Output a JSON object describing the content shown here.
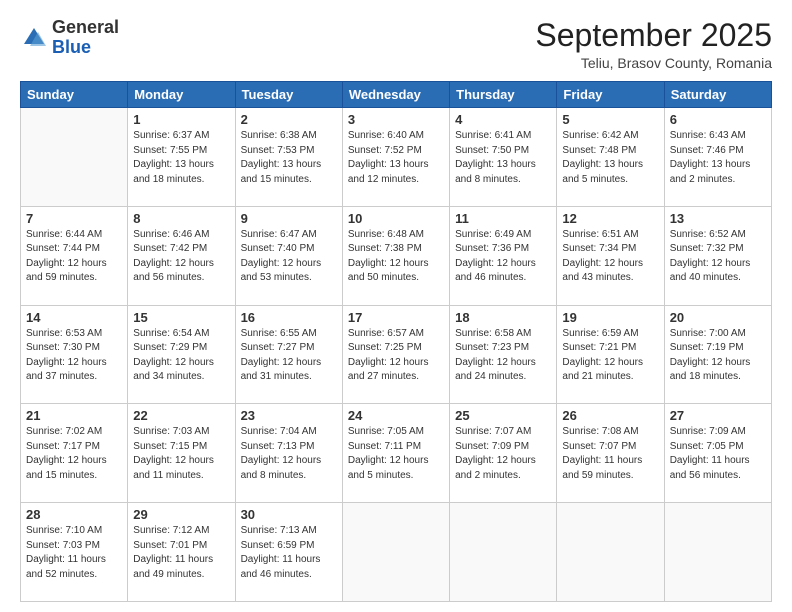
{
  "logo": {
    "general": "General",
    "blue": "Blue"
  },
  "header": {
    "month": "September 2025",
    "location": "Teliu, Brasov County, Romania"
  },
  "weekdays": [
    "Sunday",
    "Monday",
    "Tuesday",
    "Wednesday",
    "Thursday",
    "Friday",
    "Saturday"
  ],
  "weeks": [
    [
      {
        "day": "",
        "info": ""
      },
      {
        "day": "1",
        "info": "Sunrise: 6:37 AM\nSunset: 7:55 PM\nDaylight: 13 hours\nand 18 minutes."
      },
      {
        "day": "2",
        "info": "Sunrise: 6:38 AM\nSunset: 7:53 PM\nDaylight: 13 hours\nand 15 minutes."
      },
      {
        "day": "3",
        "info": "Sunrise: 6:40 AM\nSunset: 7:52 PM\nDaylight: 13 hours\nand 12 minutes."
      },
      {
        "day": "4",
        "info": "Sunrise: 6:41 AM\nSunset: 7:50 PM\nDaylight: 13 hours\nand 8 minutes."
      },
      {
        "day": "5",
        "info": "Sunrise: 6:42 AM\nSunset: 7:48 PM\nDaylight: 13 hours\nand 5 minutes."
      },
      {
        "day": "6",
        "info": "Sunrise: 6:43 AM\nSunset: 7:46 PM\nDaylight: 13 hours\nand 2 minutes."
      }
    ],
    [
      {
        "day": "7",
        "info": "Sunrise: 6:44 AM\nSunset: 7:44 PM\nDaylight: 12 hours\nand 59 minutes."
      },
      {
        "day": "8",
        "info": "Sunrise: 6:46 AM\nSunset: 7:42 PM\nDaylight: 12 hours\nand 56 minutes."
      },
      {
        "day": "9",
        "info": "Sunrise: 6:47 AM\nSunset: 7:40 PM\nDaylight: 12 hours\nand 53 minutes."
      },
      {
        "day": "10",
        "info": "Sunrise: 6:48 AM\nSunset: 7:38 PM\nDaylight: 12 hours\nand 50 minutes."
      },
      {
        "day": "11",
        "info": "Sunrise: 6:49 AM\nSunset: 7:36 PM\nDaylight: 12 hours\nand 46 minutes."
      },
      {
        "day": "12",
        "info": "Sunrise: 6:51 AM\nSunset: 7:34 PM\nDaylight: 12 hours\nand 43 minutes."
      },
      {
        "day": "13",
        "info": "Sunrise: 6:52 AM\nSunset: 7:32 PM\nDaylight: 12 hours\nand 40 minutes."
      }
    ],
    [
      {
        "day": "14",
        "info": "Sunrise: 6:53 AM\nSunset: 7:30 PM\nDaylight: 12 hours\nand 37 minutes."
      },
      {
        "day": "15",
        "info": "Sunrise: 6:54 AM\nSunset: 7:29 PM\nDaylight: 12 hours\nand 34 minutes."
      },
      {
        "day": "16",
        "info": "Sunrise: 6:55 AM\nSunset: 7:27 PM\nDaylight: 12 hours\nand 31 minutes."
      },
      {
        "day": "17",
        "info": "Sunrise: 6:57 AM\nSunset: 7:25 PM\nDaylight: 12 hours\nand 27 minutes."
      },
      {
        "day": "18",
        "info": "Sunrise: 6:58 AM\nSunset: 7:23 PM\nDaylight: 12 hours\nand 24 minutes."
      },
      {
        "day": "19",
        "info": "Sunrise: 6:59 AM\nSunset: 7:21 PM\nDaylight: 12 hours\nand 21 minutes."
      },
      {
        "day": "20",
        "info": "Sunrise: 7:00 AM\nSunset: 7:19 PM\nDaylight: 12 hours\nand 18 minutes."
      }
    ],
    [
      {
        "day": "21",
        "info": "Sunrise: 7:02 AM\nSunset: 7:17 PM\nDaylight: 12 hours\nand 15 minutes."
      },
      {
        "day": "22",
        "info": "Sunrise: 7:03 AM\nSunset: 7:15 PM\nDaylight: 12 hours\nand 11 minutes."
      },
      {
        "day": "23",
        "info": "Sunrise: 7:04 AM\nSunset: 7:13 PM\nDaylight: 12 hours\nand 8 minutes."
      },
      {
        "day": "24",
        "info": "Sunrise: 7:05 AM\nSunset: 7:11 PM\nDaylight: 12 hours\nand 5 minutes."
      },
      {
        "day": "25",
        "info": "Sunrise: 7:07 AM\nSunset: 7:09 PM\nDaylight: 12 hours\nand 2 minutes."
      },
      {
        "day": "26",
        "info": "Sunrise: 7:08 AM\nSunset: 7:07 PM\nDaylight: 11 hours\nand 59 minutes."
      },
      {
        "day": "27",
        "info": "Sunrise: 7:09 AM\nSunset: 7:05 PM\nDaylight: 11 hours\nand 56 minutes."
      }
    ],
    [
      {
        "day": "28",
        "info": "Sunrise: 7:10 AM\nSunset: 7:03 PM\nDaylight: 11 hours\nand 52 minutes."
      },
      {
        "day": "29",
        "info": "Sunrise: 7:12 AM\nSunset: 7:01 PM\nDaylight: 11 hours\nand 49 minutes."
      },
      {
        "day": "30",
        "info": "Sunrise: 7:13 AM\nSunset: 6:59 PM\nDaylight: 11 hours\nand 46 minutes."
      },
      {
        "day": "",
        "info": ""
      },
      {
        "day": "",
        "info": ""
      },
      {
        "day": "",
        "info": ""
      },
      {
        "day": "",
        "info": ""
      }
    ]
  ]
}
